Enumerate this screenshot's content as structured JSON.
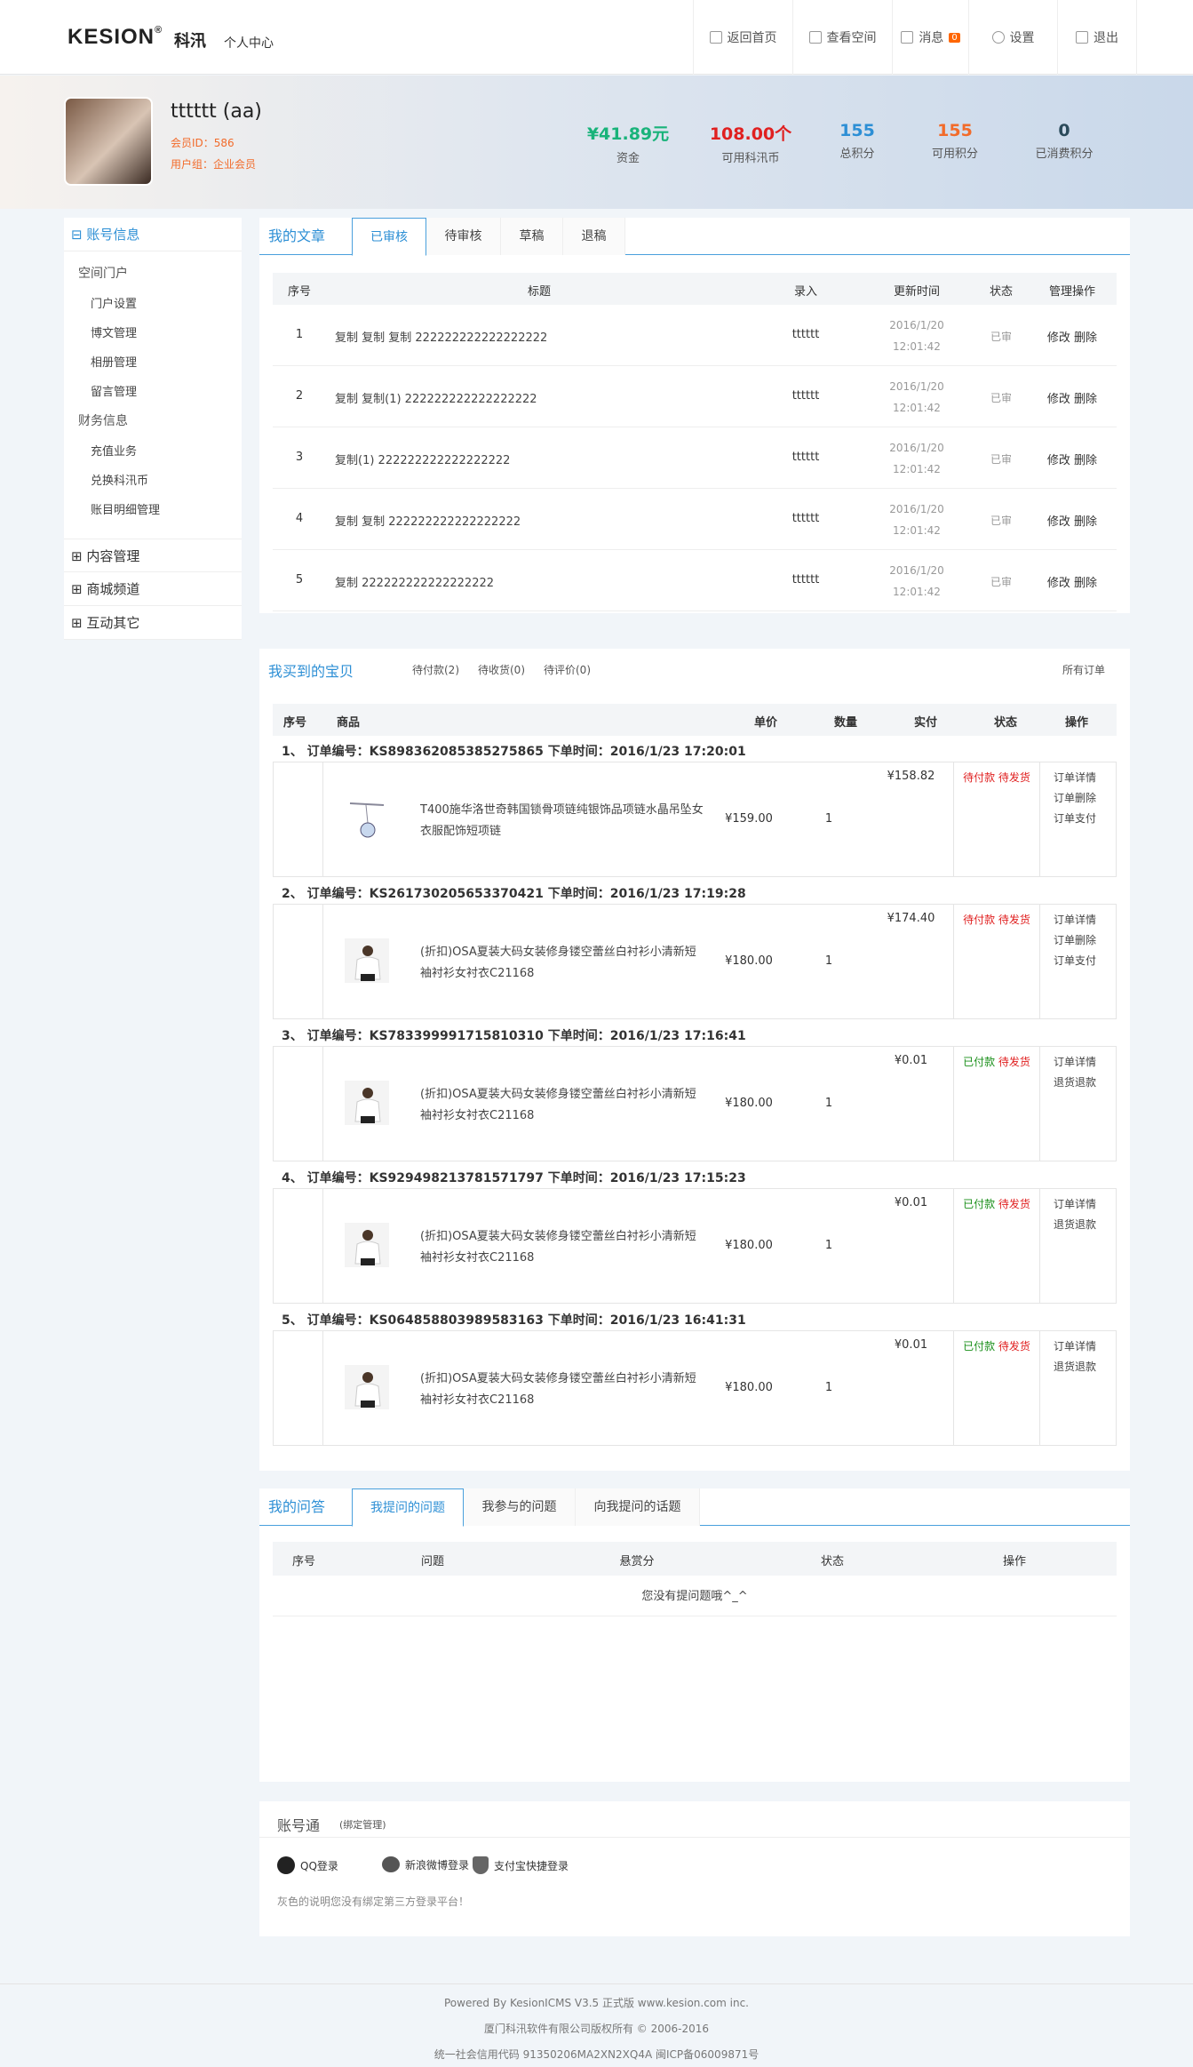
{
  "header": {
    "logo": "KESION",
    "logo_cn": "科汛",
    "center": "个人中心",
    "nav": [
      {
        "label": "返回首页",
        "icon": "home-icon"
      },
      {
        "label": "查看空间",
        "icon": "box-icon"
      },
      {
        "label": "消息",
        "badge": "0",
        "icon": "message-icon"
      },
      {
        "label": "设置",
        "icon": "gear-icon"
      },
      {
        "label": "退出",
        "icon": "logout-icon"
      }
    ]
  },
  "user": {
    "name": "tttttt (aa)",
    "id": "会员ID：586",
    "group": "用户组：企业会员"
  },
  "stats": [
    {
      "value": "¥41.89元",
      "label": "资金",
      "color": "#19b37a"
    },
    {
      "value": "108.00个",
      "label": "可用科汛币",
      "color": "#e02020"
    },
    {
      "value": "155",
      "label": "总积分",
      "color": "#2d8fd5"
    },
    {
      "value": "155",
      "label": "可用积分",
      "color": "#f26b2a"
    },
    {
      "value": "0",
      "label": "已消费积分",
      "color": "#2a4a5a"
    }
  ],
  "sidebar": {
    "account": "账号信息",
    "groups": [
      {
        "title": "空间门户",
        "links": [
          "门户设置",
          "博文管理",
          "相册管理",
          "留言管理"
        ]
      },
      {
        "title": "财务信息",
        "links": [
          "充值业务",
          "兑换科汛币",
          "账目明细管理"
        ]
      }
    ],
    "sections": [
      "内容管理",
      "商城频道",
      "互动其它"
    ]
  },
  "articles": {
    "title": "我的文章",
    "tabs": [
      "已审核",
      "待审核",
      "草稿",
      "退稿"
    ],
    "headers": [
      "序号",
      "标题",
      "录入",
      "更新时间",
      "状态",
      "管理操作"
    ],
    "rows": [
      {
        "no": "1",
        "title": "复制 复制 复制 222222222222222222",
        "author": "tttttt",
        "date": "2016/1/20",
        "time": "12:01:42",
        "status": "已审",
        "ops": "修改 删除"
      },
      {
        "no": "2",
        "title": "复制 复制(1) 222222222222222222",
        "author": "tttttt",
        "date": "2016/1/20",
        "time": "12:01:42",
        "status": "已审",
        "ops": "修改 删除"
      },
      {
        "no": "3",
        "title": "复制(1) 222222222222222222",
        "author": "tttttt",
        "date": "2016/1/20",
        "time": "12:01:42",
        "status": "已审",
        "ops": "修改 删除"
      },
      {
        "no": "4",
        "title": "复制 复制 222222222222222222",
        "author": "tttttt",
        "date": "2016/1/20",
        "time": "12:01:42",
        "status": "已审",
        "ops": "修改 删除"
      },
      {
        "no": "5",
        "title": "复制 222222222222222222",
        "author": "tttttt",
        "date": "2016/1/20",
        "time": "12:01:42",
        "status": "已审",
        "ops": "修改 删除"
      }
    ]
  },
  "orders": {
    "title": "我买到的宝贝",
    "filters": [
      "待付款(2)",
      "待收货(0)",
      "待评价(0)"
    ],
    "all": "所有订单",
    "headers": [
      "序号",
      "商品",
      "单价",
      "数量",
      "实付",
      "状态",
      "操作"
    ],
    "rows": [
      {
        "head": "1、 订单编号：KS898362085385275865   下单时间：2016/1/23 17:20:01",
        "product": "T400施华洛世奇韩国锁骨项链纯银饰品项链水晶吊坠女衣服配饰短项链",
        "price": "¥159.00",
        "qty": "1",
        "paid": "¥158.82",
        "pay_status": "待付款",
        "ship_status": "待发货",
        "ops": [
          "订单详情",
          "订单删除",
          "订单支付"
        ],
        "paid_flag": false
      },
      {
        "head": "2、 订单编号：KS261730205653370421   下单时间：2016/1/23 17:19:28",
        "product": "(折扣)OSA夏装大码女装修身镂空蕾丝白衬衫小清新短袖衬衫女衬衣C21168",
        "price": "¥180.00",
        "qty": "1",
        "paid": "¥174.40",
        "pay_status": "待付款",
        "ship_status": "待发货",
        "ops": [
          "订单详情",
          "订单删除",
          "订单支付"
        ],
        "paid_flag": false
      },
      {
        "head": "3、 订单编号：KS783399991715810310   下单时间：2016/1/23 17:16:41",
        "product": "(折扣)OSA夏装大码女装修身镂空蕾丝白衬衫小清新短袖衬衫女衬衣C21168",
        "price": "¥180.00",
        "qty": "1",
        "paid": "¥0.01",
        "pay_status": "已付款",
        "ship_status": "待发货",
        "ops": [
          "订单详情",
          "退货退款"
        ],
        "paid_flag": true
      },
      {
        "head": "4、 订单编号：KS929498213781571797   下单时间：2016/1/23 17:15:23",
        "product": "(折扣)OSA夏装大码女装修身镂空蕾丝白衬衫小清新短袖衬衫女衬衣C21168",
        "price": "¥180.00",
        "qty": "1",
        "paid": "¥0.01",
        "pay_status": "已付款",
        "ship_status": "待发货",
        "ops": [
          "订单详情",
          "退货退款"
        ],
        "paid_flag": true
      },
      {
        "head": "5、 订单编号：KS064858803989583163   下单时间：2016/1/23 16:41:31",
        "product": "(折扣)OSA夏装大码女装修身镂空蕾丝白衬衫小清新短袖衬衫女衬衣C21168",
        "price": "¥180.00",
        "qty": "1",
        "paid": "¥0.01",
        "pay_status": "已付款",
        "ship_status": "待发货",
        "ops": [
          "订单详情",
          "退货退款"
        ],
        "paid_flag": true
      }
    ]
  },
  "qa": {
    "title": "我的问答",
    "tabs": [
      "我提问的问题",
      "我参与的问题",
      "向我提问的话题"
    ],
    "headers": [
      "序号",
      "问题",
      "悬赏分",
      "状态",
      "操作"
    ],
    "empty": "您没有提问题哦^_^"
  },
  "bind": {
    "title": "账号通",
    "sub": "(绑定管理)",
    "items": [
      {
        "label": "QQ登录",
        "icon": "qq-icon"
      },
      {
        "label": "新浪微博登录",
        "icon": "weibo-icon"
      },
      {
        "label": "支付宝快捷登录",
        "icon": "alipay-icon"
      }
    ],
    "note": "灰色的说明您没有绑定第三方登录平台！"
  },
  "footer": {
    "line1": "Powered By KesionICMS V3.5 正式版 www.kesion.com inc.",
    "line2": "厦门科汛软件有限公司版权所有 © 2006-2016",
    "line3": "统一社会信用代码 91350206MA2XN2XQ4A 闽ICP备06009871号"
  }
}
